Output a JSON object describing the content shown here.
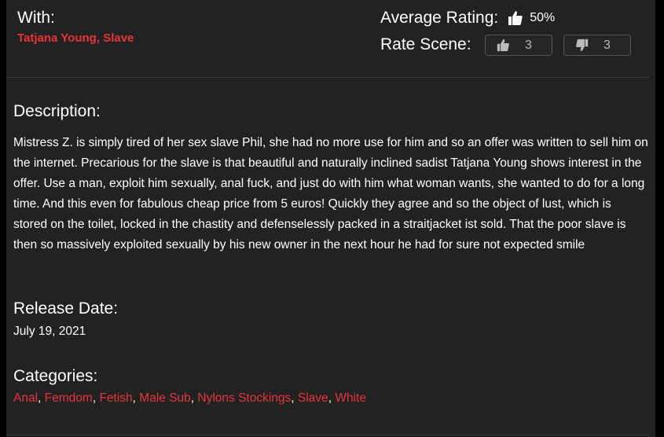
{
  "with": {
    "label": "With:",
    "performers": [
      "Tatjana Young",
      "Slave"
    ]
  },
  "rating": {
    "average_label": "Average Rating:",
    "average_icon": "thumbs-up-icon",
    "average_value": "50%",
    "rate_label": "Rate Scene:",
    "up_count": "3",
    "down_count": "3"
  },
  "description": {
    "title": "Description:",
    "text": "Mistress Z. is simply tired of her sex slave Phil, she had no more use for him and so an offer was written to sell him on the internet. Precarious for the slave is that beautiful and naturally inclined sadist Tatjana Young shows interest in the offer. Use a man, exploit him sexually, anal fuck, and just do with him what woman wants, she wanted to do for a long time. And this even for fabulous cheap price from 5 euros! Quickly they agree and so the object of lust, which is stored on the toilet, locked in the chastity and defenselessly packed in a straitjacket ist sold. That the poor slave is then so massively exploited sexually by his new owner in the next hour he had for sure not expected smile"
  },
  "release": {
    "title": "Release Date:",
    "date": "July 19, 2021"
  },
  "categories": {
    "title": "Categories:",
    "items": [
      "Anal",
      "Femdom",
      "Fetish",
      "Male Sub",
      "Nylons Stockings",
      "Slave",
      "White"
    ]
  },
  "colors": {
    "accent": "#e8333a",
    "background": "#222222"
  }
}
